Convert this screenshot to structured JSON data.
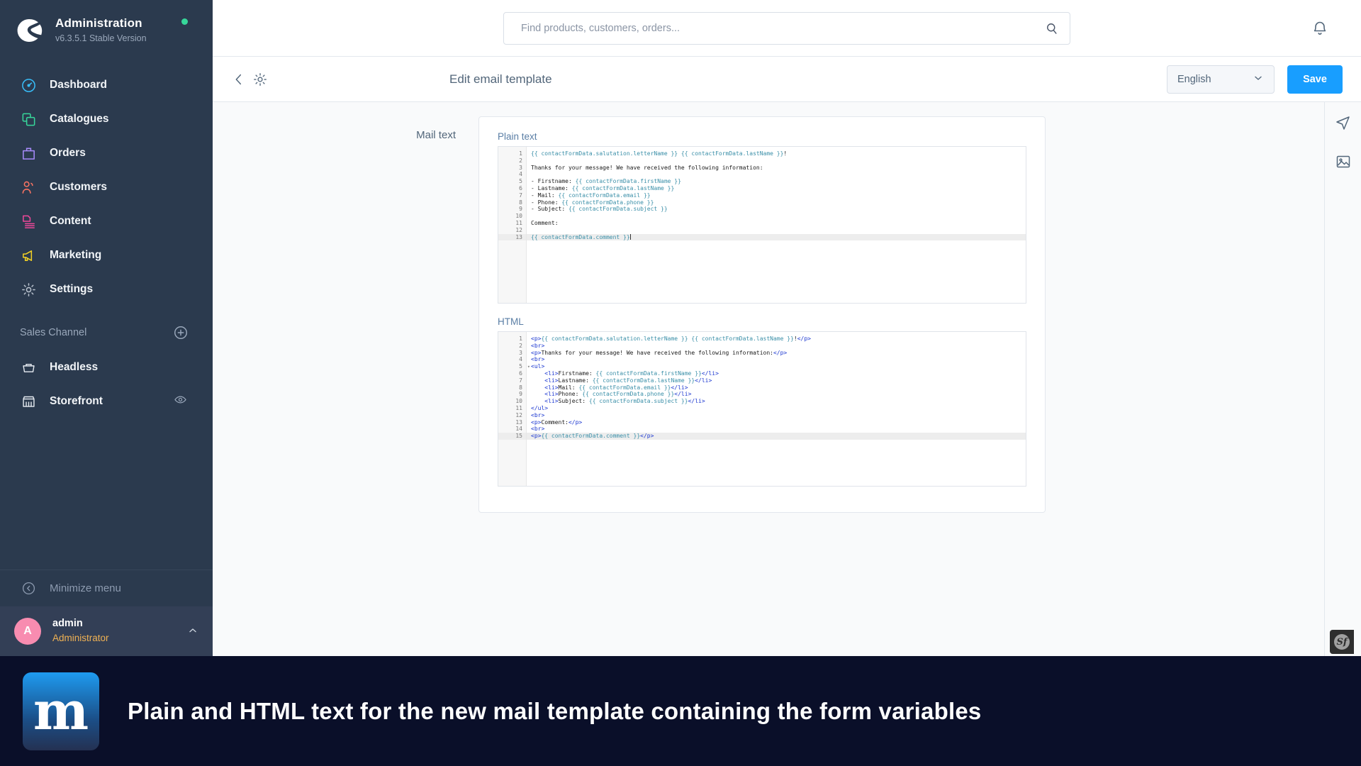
{
  "brand": {
    "title": "Administration",
    "version": "v6.3.5.1 Stable Version",
    "logo_icon": "shopware-logo-icon",
    "status_icon": "status-online-dot"
  },
  "sidebar": {
    "items": [
      {
        "label": "Dashboard",
        "icon": "dashboard-icon",
        "color": "#38bdf8"
      },
      {
        "label": "Catalogues",
        "icon": "catalogues-icon",
        "color": "#37d79a"
      },
      {
        "label": "Orders",
        "icon": "orders-icon",
        "color": "#a78bfa"
      },
      {
        "label": "Customers",
        "icon": "customers-icon",
        "color": "#f97362"
      },
      {
        "label": "Content",
        "icon": "content-icon",
        "color": "#ec4899"
      },
      {
        "label": "Marketing",
        "icon": "marketing-icon",
        "color": "#f2d024"
      },
      {
        "label": "Settings",
        "icon": "gear-icon",
        "color": "#b8c1cd"
      }
    ],
    "section_title": "Sales Channel",
    "add_channel_icon": "plus-circle-icon",
    "channels": [
      {
        "label": "Headless",
        "icon": "basket-icon",
        "trailing_icon": ""
      },
      {
        "label": "Storefront",
        "icon": "storefront-icon",
        "trailing_icon": "eye-icon"
      }
    ],
    "minimize_label": "Minimize menu",
    "minimize_icon": "chevron-left-circle-icon",
    "user": {
      "avatar_initial": "A",
      "avatar_color": "#f88cb0",
      "name": "admin",
      "role": "Administrator",
      "caret_icon": "chevron-up-icon"
    }
  },
  "topbar": {
    "search_placeholder": "Find products, customers, orders...",
    "search_value": "",
    "search_icon": "search-icon",
    "notification_icon": "bell-icon"
  },
  "subheader": {
    "back_icon": "chevron-left-icon",
    "gear_icon": "gear-icon",
    "title": "Edit email template",
    "language": "English",
    "language_caret_icon": "chevron-down-icon",
    "save_label": "Save",
    "save_color": "#189eff"
  },
  "main": {
    "field_label": "Mail text",
    "plain": {
      "label": "Plain text",
      "active_line": 13,
      "lines": [
        {
          "n": 1,
          "segs": [
            {
              "t": "{{ contactFormData.salutation.letterName }} {{ contactFormData.lastName }}",
              "c": "var"
            },
            {
              "t": "!",
              "c": ""
            }
          ]
        },
        {
          "n": 2,
          "segs": [
            {
              "t": "",
              "c": ""
            }
          ]
        },
        {
          "n": 3,
          "segs": [
            {
              "t": "Thanks for your message! We have received the following information:",
              "c": ""
            }
          ]
        },
        {
          "n": 4,
          "segs": [
            {
              "t": "",
              "c": ""
            }
          ]
        },
        {
          "n": 5,
          "segs": [
            {
              "t": "- Firstname: ",
              "c": ""
            },
            {
              "t": "{{ contactFormData.firstName }}",
              "c": "var"
            }
          ]
        },
        {
          "n": 6,
          "segs": [
            {
              "t": "- Lastname: ",
              "c": ""
            },
            {
              "t": "{{ contactFormData.lastName }}",
              "c": "var"
            }
          ]
        },
        {
          "n": 7,
          "segs": [
            {
              "t": "- Mail: ",
              "c": ""
            },
            {
              "t": "{{ contactFormData.email }}",
              "c": "var"
            }
          ]
        },
        {
          "n": 8,
          "segs": [
            {
              "t": "- Phone: ",
              "c": ""
            },
            {
              "t": "{{ contactFormData.phone }}",
              "c": "var"
            }
          ]
        },
        {
          "n": 9,
          "segs": [
            {
              "t": "- Subject: ",
              "c": ""
            },
            {
              "t": "{{ contactFormData.subject }}",
              "c": "var"
            }
          ]
        },
        {
          "n": 10,
          "segs": [
            {
              "t": "",
              "c": ""
            }
          ]
        },
        {
          "n": 11,
          "segs": [
            {
              "t": "Comment:",
              "c": ""
            }
          ]
        },
        {
          "n": 12,
          "segs": [
            {
              "t": "",
              "c": ""
            }
          ]
        },
        {
          "n": 13,
          "segs": [
            {
              "t": "{{ contactFormData.comment }}",
              "c": "var"
            },
            {
              "t": "|",
              "c": "caret"
            }
          ]
        }
      ]
    },
    "html": {
      "label": "HTML",
      "active_line": 15,
      "fold_line": 5,
      "lines": [
        {
          "n": 1,
          "segs": [
            {
              "t": "<p>",
              "c": "tag"
            },
            {
              "t": "{{ contactFormData.salutation.letterName }} {{ contactFormData.lastName }}",
              "c": "var"
            },
            {
              "t": "!",
              "c": ""
            },
            {
              "t": "</p>",
              "c": "tag"
            }
          ]
        },
        {
          "n": 2,
          "segs": [
            {
              "t": "<br>",
              "c": "tag"
            }
          ]
        },
        {
          "n": 3,
          "segs": [
            {
              "t": "<p>",
              "c": "tag"
            },
            {
              "t": "Thanks for your message! We have received the following information:",
              "c": ""
            },
            {
              "t": "</p>",
              "c": "tag"
            }
          ]
        },
        {
          "n": 4,
          "segs": [
            {
              "t": "<br>",
              "c": "tag"
            }
          ]
        },
        {
          "n": 5,
          "segs": [
            {
              "t": "<ul>",
              "c": "tag"
            }
          ]
        },
        {
          "n": 6,
          "segs": [
            {
              "t": "    ",
              "c": ""
            },
            {
              "t": "<li>",
              "c": "tag"
            },
            {
              "t": "Firstname: ",
              "c": ""
            },
            {
              "t": "{{ contactFormData.firstName }}",
              "c": "var"
            },
            {
              "t": "</li>",
              "c": "tag"
            }
          ]
        },
        {
          "n": 7,
          "segs": [
            {
              "t": "    ",
              "c": ""
            },
            {
              "t": "<li>",
              "c": "tag"
            },
            {
              "t": "Lastname: ",
              "c": ""
            },
            {
              "t": "{{ contactFormData.lastName }}",
              "c": "var"
            },
            {
              "t": "</li>",
              "c": "tag"
            }
          ]
        },
        {
          "n": 8,
          "segs": [
            {
              "t": "    ",
              "c": ""
            },
            {
              "t": "<li>",
              "c": "tag"
            },
            {
              "t": "Mail: ",
              "c": ""
            },
            {
              "t": "{{ contactFormData.email }}",
              "c": "var"
            },
            {
              "t": "</li>",
              "c": "tag"
            }
          ]
        },
        {
          "n": 9,
          "segs": [
            {
              "t": "    ",
              "c": ""
            },
            {
              "t": "<li>",
              "c": "tag"
            },
            {
              "t": "Phone: ",
              "c": ""
            },
            {
              "t": "{{ contactFormData.phone }}",
              "c": "var"
            },
            {
              "t": "</li>",
              "c": "tag"
            }
          ]
        },
        {
          "n": 10,
          "segs": [
            {
              "t": "    ",
              "c": ""
            },
            {
              "t": "<li>",
              "c": "tag"
            },
            {
              "t": "Subject: ",
              "c": ""
            },
            {
              "t": "{{ contactFormData.subject }}",
              "c": "var"
            },
            {
              "t": "</li>",
              "c": "tag"
            }
          ]
        },
        {
          "n": 11,
          "segs": [
            {
              "t": "</ul>",
              "c": "tag"
            }
          ]
        },
        {
          "n": 12,
          "segs": [
            {
              "t": "<br>",
              "c": "tag"
            }
          ]
        },
        {
          "n": 13,
          "segs": [
            {
              "t": "<p>",
              "c": "tag"
            },
            {
              "t": "Comment:",
              "c": ""
            },
            {
              "t": "</p>",
              "c": "tag"
            }
          ]
        },
        {
          "n": 14,
          "segs": [
            {
              "t": "<br>",
              "c": "tag"
            }
          ]
        },
        {
          "n": 15,
          "segs": [
            {
              "t": "<p>",
              "c": "tag"
            },
            {
              "t": "{{ contactFormData.comment }}",
              "c": "var"
            },
            {
              "t": "</p>",
              "c": "tag"
            }
          ]
        }
      ]
    }
  },
  "right_rail": {
    "buttons": [
      {
        "icon": "send-mail-icon"
      },
      {
        "icon": "media-image-icon"
      }
    ]
  },
  "debug_badge": {
    "icon": "symfony-profiler-icon",
    "glyph": "Sf"
  },
  "banner": {
    "logo_text": "m",
    "caption": "Plain and HTML text for the new mail template containing the form variables",
    "background": "#0a0f29"
  }
}
